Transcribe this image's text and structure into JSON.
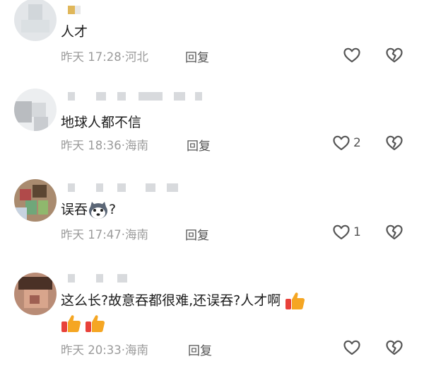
{
  "comments": [
    {
      "text": "人才",
      "time": "昨天 17:28",
      "location": "河北",
      "reply_label": "回复",
      "likes": ""
    },
    {
      "text": "地球人都不信",
      "time": "昨天 18:36",
      "location": "海南",
      "reply_label": "回复",
      "likes": "2"
    },
    {
      "text_before": "误吞",
      "text_after": "?",
      "time": "昨天 17:47",
      "location": "海南",
      "reply_label": "回复",
      "likes": "1"
    },
    {
      "text": "这么长?故意吞都很难,还误吞?人才啊",
      "time": "昨天 20:33",
      "location": "海南",
      "reply_label": "回复",
      "likes": ""
    }
  ],
  "separator": "·",
  "icons": {
    "like": "heart-outline-icon",
    "dislike": "broken-heart-icon",
    "emoji_dog": "husky-emoji-icon",
    "emoji_thumbs": "thumbs-up-emoji-icon"
  },
  "colors": {
    "meta": "#9b9b9b",
    "icon": "#555555",
    "thumb": "#f5a623"
  }
}
